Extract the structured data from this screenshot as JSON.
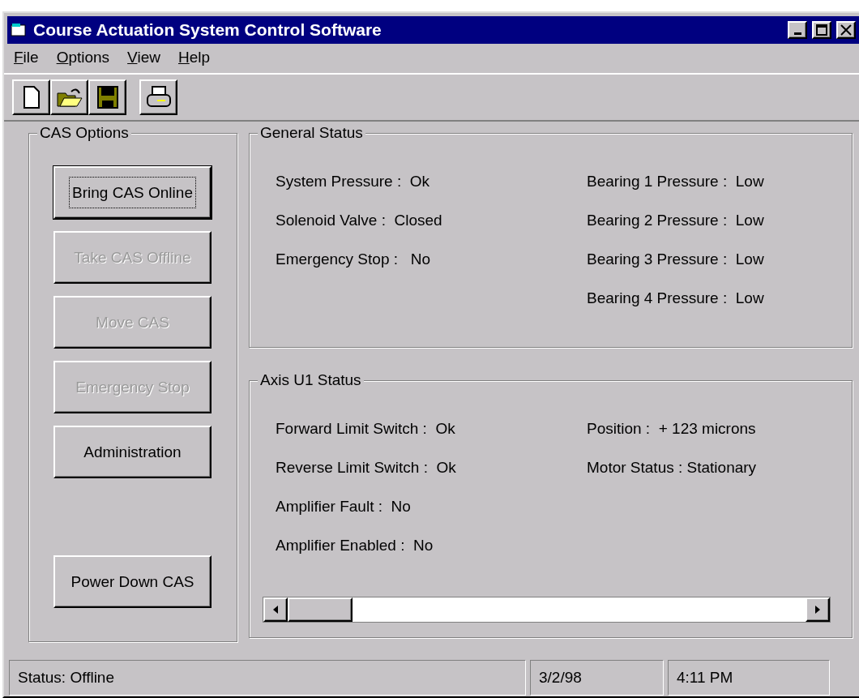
{
  "window": {
    "title": "Course Actuation System Control Software"
  },
  "menu": [
    {
      "accel": "F",
      "rest": "ile"
    },
    {
      "accel": "O",
      "rest": "ptions"
    },
    {
      "accel": "V",
      "rest": "iew"
    },
    {
      "accel": "H",
      "rest": "elp"
    }
  ],
  "toolbar": [
    {
      "kind": "new"
    },
    {
      "kind": "open"
    },
    {
      "kind": "save"
    },
    {
      "kind": "print"
    }
  ],
  "cas_options": {
    "title": "CAS Options",
    "buttons": [
      {
        "label": "Bring CAS Online",
        "disabled": false,
        "focused": true
      },
      {
        "label": "Take CAS Offline",
        "disabled": true,
        "focused": false
      },
      {
        "label": "Move CAS",
        "disabled": true,
        "focused": false
      },
      {
        "label": "Emergency Stop",
        "disabled": true,
        "focused": false
      },
      {
        "label": "Administration",
        "disabled": false,
        "focused": false
      },
      {
        "label": "Power Down CAS",
        "disabled": false,
        "focused": false
      }
    ]
  },
  "general_status": {
    "title": "General Status",
    "left": [
      "System Pressure :  Ok",
      "Solenoid Valve :  Closed",
      "Emergency Stop :   No"
    ],
    "right": [
      "Bearing 1 Pressure :  Low",
      "Bearing 2 Pressure :  Low",
      "Bearing 3 Pressure :  Low",
      "Bearing 4 Pressure :  Low"
    ]
  },
  "axis_status": {
    "title": "Axis U1 Status",
    "left": [
      "Forward Limit Switch :  Ok",
      "Reverse Limit Switch :  Ok",
      "Amplifier Fault :  No",
      "Amplifier Enabled :  No"
    ],
    "right": [
      "Position :  + 123 microns",
      "Motor Status : Stationary"
    ]
  },
  "status_bar": {
    "status": "Status:  Offline",
    "date": "3/2/98",
    "time": "4:11 PM"
  }
}
